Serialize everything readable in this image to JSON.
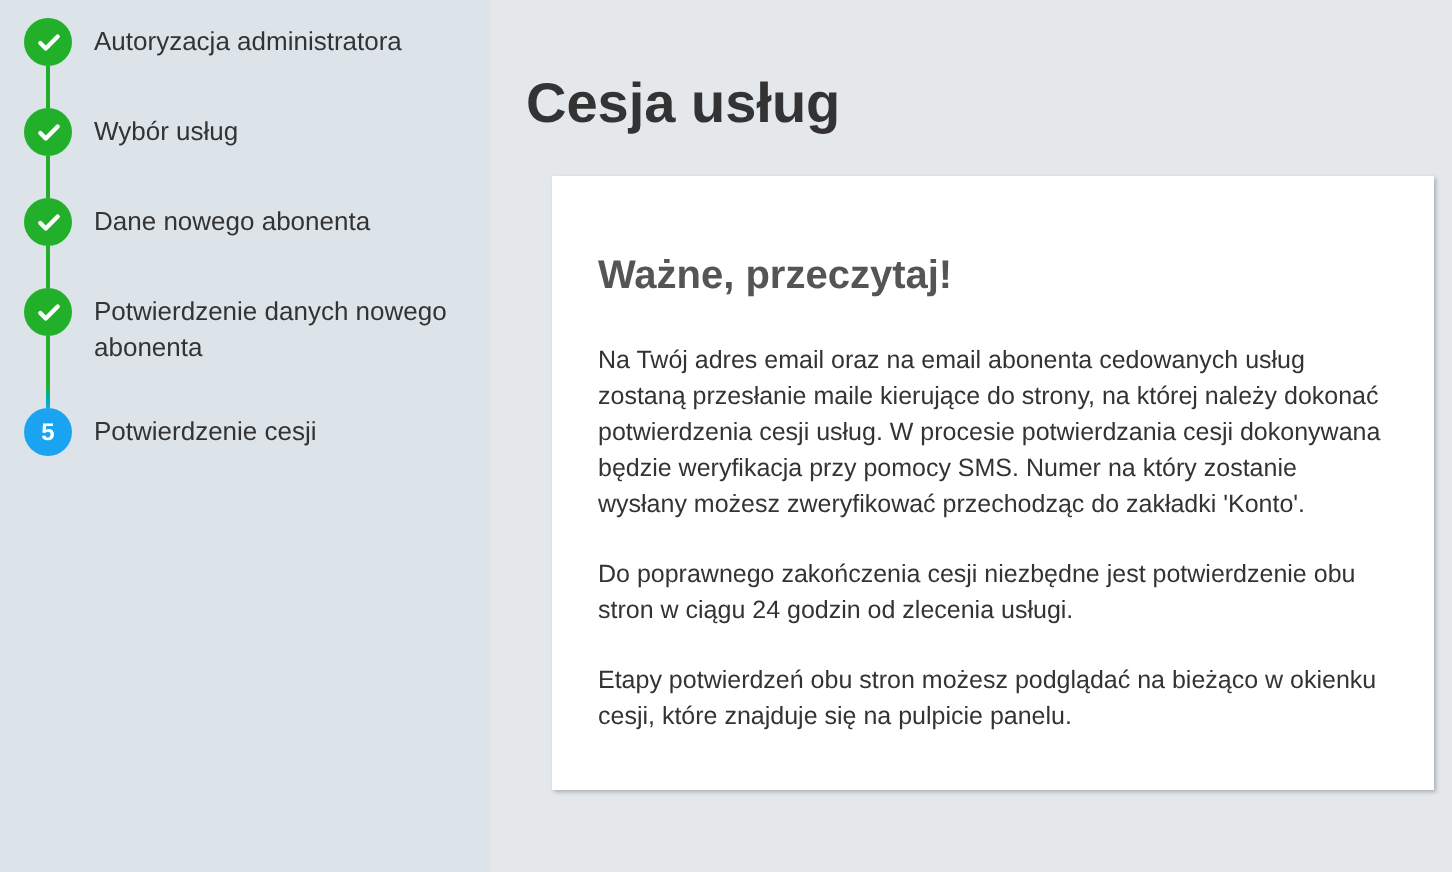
{
  "steps": [
    {
      "label": "Autoryzacja administratora",
      "kind": "done"
    },
    {
      "label": "Wybór usług",
      "kind": "done"
    },
    {
      "label": "Dane nowego abonenta",
      "kind": "done"
    },
    {
      "label": "Potwierdzenie danych nowego abonenta",
      "kind": "done"
    },
    {
      "label": "Potwierdzenie cesji",
      "kind": "current",
      "number": "5"
    }
  ],
  "page_title": "Cesja usług",
  "card": {
    "heading": "Ważne, przeczytaj!",
    "paragraphs": [
      "Na Twój adres email oraz na email abonenta cedowanych usług zostaną przesłanie maile kierujące do strony, na której należy dokonać potwierdzenia cesji usług. W procesie potwierdzania cesji dokonywana będzie weryfikacja przy pomocy SMS. Numer na który zostanie wysłany możesz zweryfikować przechodząc do zakładki 'Konto'.",
      "Do poprawnego zakończenia cesji niezbędne jest potwierdzenie obu stron w ciągu 24 godzin od zlecenia usługi.",
      "Etapy potwierdzeń obu stron możesz podglądać na bieżąco w okienku cesji, które znajduje się na pulpicie panelu."
    ]
  }
}
